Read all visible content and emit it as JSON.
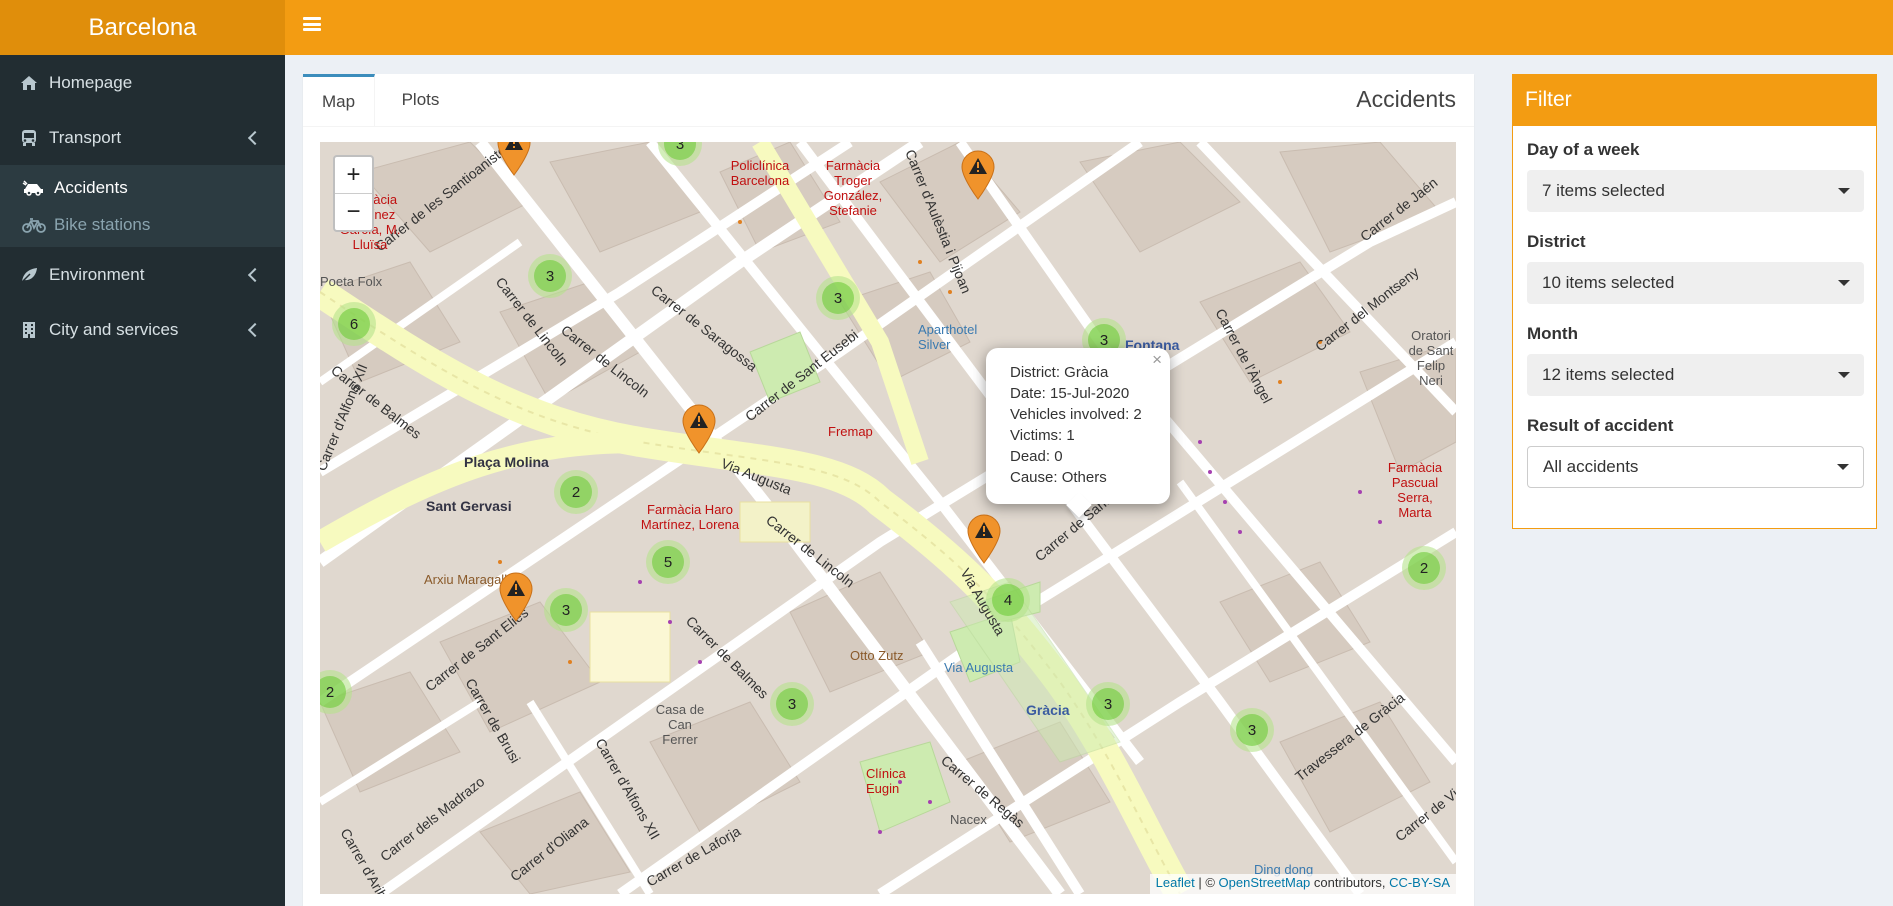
{
  "app": {
    "title": "Barcelona"
  },
  "sidebar": {
    "items": [
      {
        "label": "Homepage",
        "icon": "home-icon"
      },
      {
        "label": "Transport",
        "icon": "bus-icon"
      },
      {
        "label": "Environment",
        "icon": "leaf-icon"
      },
      {
        "label": "City and services",
        "icon": "building-icon"
      }
    ],
    "transport_sub": [
      {
        "label": "Accidents",
        "icon": "car-crash-icon",
        "active": true
      },
      {
        "label": "Bike stations",
        "icon": "bicycle-icon",
        "active": false
      }
    ]
  },
  "tabs": {
    "map": "Map",
    "plots": "Plots",
    "title": "Accidents"
  },
  "map": {
    "zoom_in": "+",
    "zoom_out": "−",
    "clusters": [
      "3",
      "3",
      "6",
      "3",
      "3",
      "2",
      "5",
      "3",
      "4",
      "2",
      "2",
      "3",
      "3",
      "3"
    ],
    "popup": {
      "close": "×",
      "district": "District: Gràcia",
      "date": "Date: 15-Jul-2020",
      "vehicles": "Vehicles involved: 2",
      "victims": "Victims: 1",
      "dead": "Dead: 0",
      "cause": "Cause: Others"
    },
    "labels": {
      "placa_molina": "Plaça Molina",
      "sant_gervasi": "Sant Gervasi",
      "fontana": "Fontana",
      "gracia": "Gràcia",
      "fremap": "Fremap",
      "otto_zutz": "Otto Zutz",
      "via_augusta_station": "Via Augusta",
      "arxiu": "Arxiu Maragall",
      "clinica": "Clínica Eugin",
      "nacex": "Nacex",
      "aparthotel": "Aparthotel Silver",
      "farmacia_haro": "Farmàcia Haro Martínez, Lorena",
      "farmacia_troger": "Farmàcia Troger González, Stefanie",
      "policlinica": "Policlínica Barcelona",
      "casa_can_ferrer": "Casa de Can Ferrer",
      "poeta_folx": "Poeta Folx",
      "farmacia_pascual": "Farmàcia Pascual Serra, Marta",
      "oratori": "Oratori de Sant Felip Neri",
      "farmacia_garcia": "Farmàcia Martínez García, M. Lluïsa",
      "dino_dong": "Ding dong"
    },
    "streets": {
      "santaloanistes": "Carrer de les Santioanistes",
      "lincoln_top": "Carrer de Lincoln",
      "saragossa": "Carrer de Saragossa",
      "sant_eusebi": "Carrer de Sant Eusebi",
      "aulestia": "Carrer d'Aulèstia i Pijoan",
      "angel": "Carrer de l'Àngel",
      "montseny": "Carrer del Montseny",
      "jaen": "Carrer de Jaén",
      "balmes_left": "Carrer de Balmes",
      "alfons_left": "Carrer d'Alfons XII",
      "lincoln_mid": "Carrer de Lincoln",
      "via_augusta": "Via Augusta",
      "lincoln_low": "Carrer de Lincoln",
      "balmes_low": "Carrer de Balmes",
      "sant_marc": "Carrer de Sant Marc",
      "sant_elies": "Carrer de Sant Elies",
      "brusi": "Carrer de Brusi",
      "madrazo": "Carrer dels Madrazo",
      "oliana": "Carrer d'Oliana",
      "alfons_low": "Carrer d'Alfons XII",
      "laforja": "Carrer de Laforja",
      "regas": "Carrer de Regàs",
      "travessera": "Travessera de Gràcia",
      "vic": "Carrer de Vic",
      "aribau": "Carrer d'Aribau",
      "via_augusta_low": "Via Augusta"
    },
    "attribution": {
      "leaflet": "Leaflet",
      "sep": " | © ",
      "osm": "OpenStreetMap",
      "contrib": " contributors, ",
      "license": "CC-BY-SA"
    }
  },
  "filter": {
    "title": "Filter",
    "day_label": "Day of a week",
    "day_value": "7 items selected",
    "district_label": "District",
    "district_value": "10 items selected",
    "month_label": "Month",
    "month_value": "12 items selected",
    "result_label": "Result of accident",
    "result_value": "All accidents"
  },
  "colors": {
    "header": "#f39c12",
    "logo_bg": "#e08e0b",
    "sidebar_bg": "#222d32",
    "accent_tab": "#3c8dbc",
    "marker": "#f0932b",
    "cluster": "#6ecc39"
  }
}
